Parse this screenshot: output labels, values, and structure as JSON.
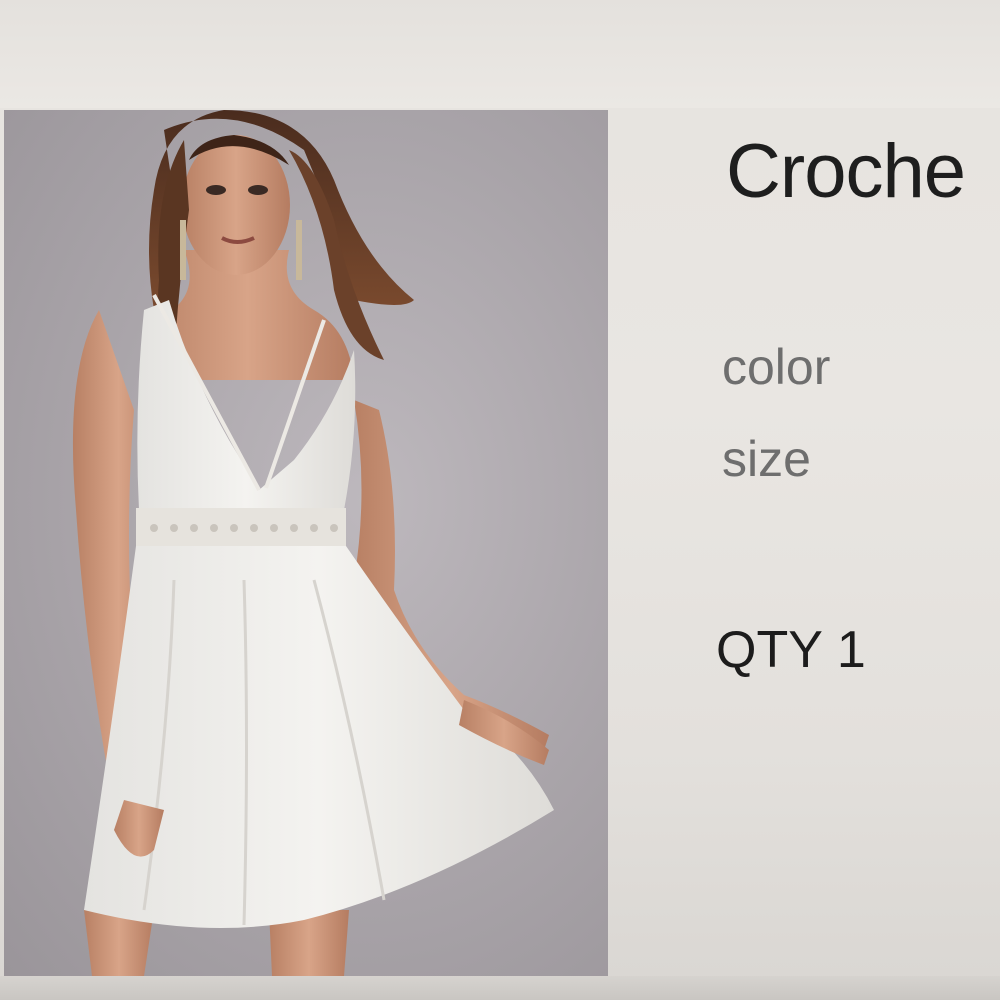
{
  "product": {
    "title": "Croche",
    "image_alt": "Model wearing white crochet-trim slip dress",
    "options": {
      "color_label": "color",
      "size_label": "size"
    },
    "quantity": {
      "label": "QTY",
      "value": "1"
    }
  },
  "colors": {
    "photo_background": "#a9a4a9",
    "dress": "#f1f0ed",
    "title_text": "#1e1e1e",
    "option_text": "#6e6e6e"
  }
}
